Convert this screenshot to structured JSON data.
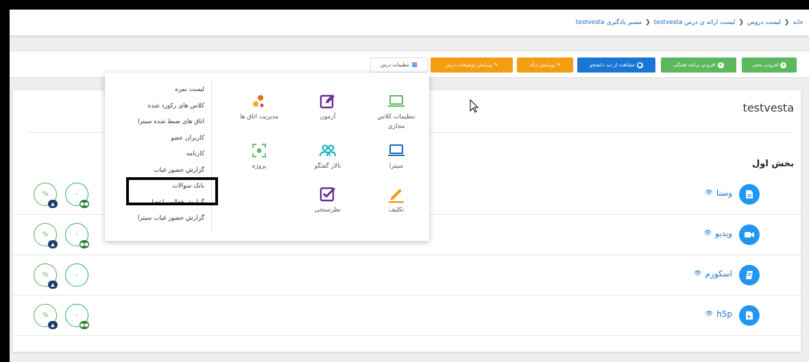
{
  "breadcrumb": {
    "items": [
      "خانه",
      "لیست دروس",
      "لیست ارائه ی درس testvesta",
      "مسیر یادگیری testvesta"
    ]
  },
  "toolbar": {
    "add_section": "افزودن بخش",
    "add_weekly": "افزودن برنامه هفتگی",
    "student_view": "مشاهده از دید دانشجو",
    "edit_offering": "ویرایش ارائه",
    "edit_description": "ویرایش توضیحات درس",
    "course_settings": "تنظیمات درس"
  },
  "course": {
    "title": "testvesta",
    "section_title": "بخش اول"
  },
  "rows": [
    {
      "name": "وستا",
      "icon": "document-icon"
    },
    {
      "name": "ویدیو",
      "icon": "video-icon"
    },
    {
      "name": "اسکورم",
      "icon": "book-icon"
    },
    {
      "name": "h5p",
      "icon": "h5p-icon"
    }
  ],
  "row_indicators": {
    "percent": "%",
    "dash": "-"
  },
  "menu": {
    "list": [
      "لیست نمره",
      "کلاس های رکورد شده",
      "اتاق های ضبط شده سیترا",
      "کاربران عضو",
      "کارنامه",
      "گزارش حضور غیاب",
      "بانک سوالات",
      "گزارش فعالیت اعضا",
      "گزارش حضور غیاب سیترا"
    ],
    "tiles": {
      "virtual_class": "تنظیمات کلاس مجازی",
      "exam": "آزمون",
      "room_management": "مدیریت اتاق ها",
      "sitra": "سیترا",
      "forum": "تالار گفتگو",
      "project": "پروژه",
      "assignment": "تکلیف",
      "survey": "نظرسنجی"
    }
  },
  "colors": {
    "green": "#5cb85c",
    "blue": "#1976d2",
    "orange": "#f49c12",
    "purple": "#6a2c91",
    "link": "#1976d2"
  }
}
